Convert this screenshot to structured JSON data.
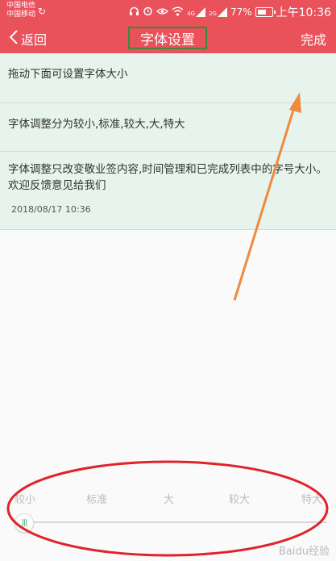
{
  "status_bar": {
    "carrier_1": "中国电信",
    "carrier_2": "中国移动",
    "signal_label_1": "4G",
    "signal_label_2": "2G",
    "battery_level": "77%",
    "time": "上午10:36"
  },
  "nav": {
    "back_label": "返回",
    "title": "字体设置",
    "done_label": "完成"
  },
  "notes": [
    {
      "text": "拖动下面可设置字体大小"
    },
    {
      "text": "字体调整分为较小,标准,较大,大,特大"
    },
    {
      "text": "字体调整只改变敬业签内容,时间管理和已完成列表中的字号大小。欢迎反馈意见给我们",
      "timestamp": "2018/08/17 10:36"
    }
  ],
  "font_size": {
    "options": [
      "较小",
      "标准",
      "大",
      "较大",
      "特大"
    ],
    "selected_index": 0
  },
  "watermark": "Baidu经验",
  "colors": {
    "accent": "#e9525b",
    "note_background": "#e7f4ee",
    "annotation_arrow": "#f08a3c",
    "annotation_circle": "#e0222a",
    "title_highlight": "#3a8a3a"
  }
}
